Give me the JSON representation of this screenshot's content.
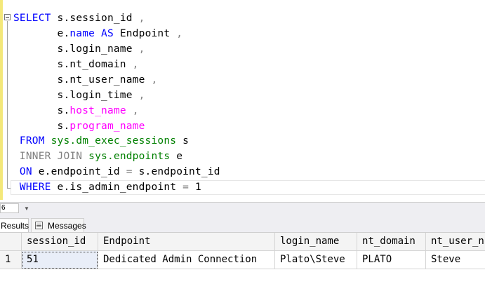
{
  "editor": {
    "lines": [
      {
        "segments": [
          {
            "t": "SELECT",
            "c": "kw"
          },
          {
            "t": " s.session_id ",
            "c": ""
          },
          {
            "t": ",",
            "c": "gray"
          }
        ]
      },
      {
        "segments": [
          {
            "t": "       e.",
            "c": ""
          },
          {
            "t": "name",
            "c": "kw"
          },
          {
            "t": " ",
            "c": ""
          },
          {
            "t": "AS",
            "c": "kw"
          },
          {
            "t": " Endpoint ",
            "c": ""
          },
          {
            "t": ",",
            "c": "gray"
          }
        ]
      },
      {
        "segments": [
          {
            "t": "       s.login_name ",
            "c": ""
          },
          {
            "t": ",",
            "c": "gray"
          }
        ]
      },
      {
        "segments": [
          {
            "t": "       s.nt_domain ",
            "c": ""
          },
          {
            "t": ",",
            "c": "gray"
          }
        ]
      },
      {
        "segments": [
          {
            "t": "       s.nt_user_name ",
            "c": ""
          },
          {
            "t": ",",
            "c": "gray"
          }
        ]
      },
      {
        "segments": [
          {
            "t": "       s.login_time ",
            "c": ""
          },
          {
            "t": ",",
            "c": "gray"
          }
        ]
      },
      {
        "segments": [
          {
            "t": "       s.",
            "c": ""
          },
          {
            "t": "host_name",
            "c": "fn"
          },
          {
            "t": " ",
            "c": ""
          },
          {
            "t": ",",
            "c": "gray"
          }
        ]
      },
      {
        "segments": [
          {
            "t": "       s.",
            "c": ""
          },
          {
            "t": "program_name",
            "c": "fn"
          }
        ]
      },
      {
        "segments": [
          {
            "t": " FROM",
            "c": "kw"
          },
          {
            "t": " ",
            "c": ""
          },
          {
            "t": "sys.dm_exec_sessions",
            "c": "sys"
          },
          {
            "t": " s",
            "c": ""
          }
        ]
      },
      {
        "segments": [
          {
            "t": " INNER JOIN",
            "c": "gray"
          },
          {
            "t": " ",
            "c": ""
          },
          {
            "t": "sys.endpoints",
            "c": "sys"
          },
          {
            "t": " e",
            "c": ""
          }
        ]
      },
      {
        "segments": [
          {
            "t": " ON",
            "c": "kw"
          },
          {
            "t": " e.endpoint_id ",
            "c": ""
          },
          {
            "t": "=",
            "c": "gray"
          },
          {
            "t": " s.endpoint_id",
            "c": ""
          }
        ]
      },
      {
        "segments": [
          {
            "t": " WHERE",
            "c": "kw"
          },
          {
            "t": " e.is_admin_endpoint ",
            "c": ""
          },
          {
            "t": "=",
            "c": "gray"
          },
          {
            "t": " 1",
            "c": ""
          }
        ]
      }
    ]
  },
  "statusbar": {
    "zoom": "6"
  },
  "tabs": {
    "results_label": "Results",
    "messages_label": "Messages"
  },
  "grid": {
    "columns": [
      "session_id",
      "Endpoint",
      "login_name",
      "nt_domain",
      "nt_user_n"
    ],
    "rows": [
      {
        "row_number": "1",
        "cells": [
          "51",
          "Dedicated Admin Connection",
          "Plato\\Steve",
          "PLATO",
          "Steve"
        ]
      }
    ]
  }
}
